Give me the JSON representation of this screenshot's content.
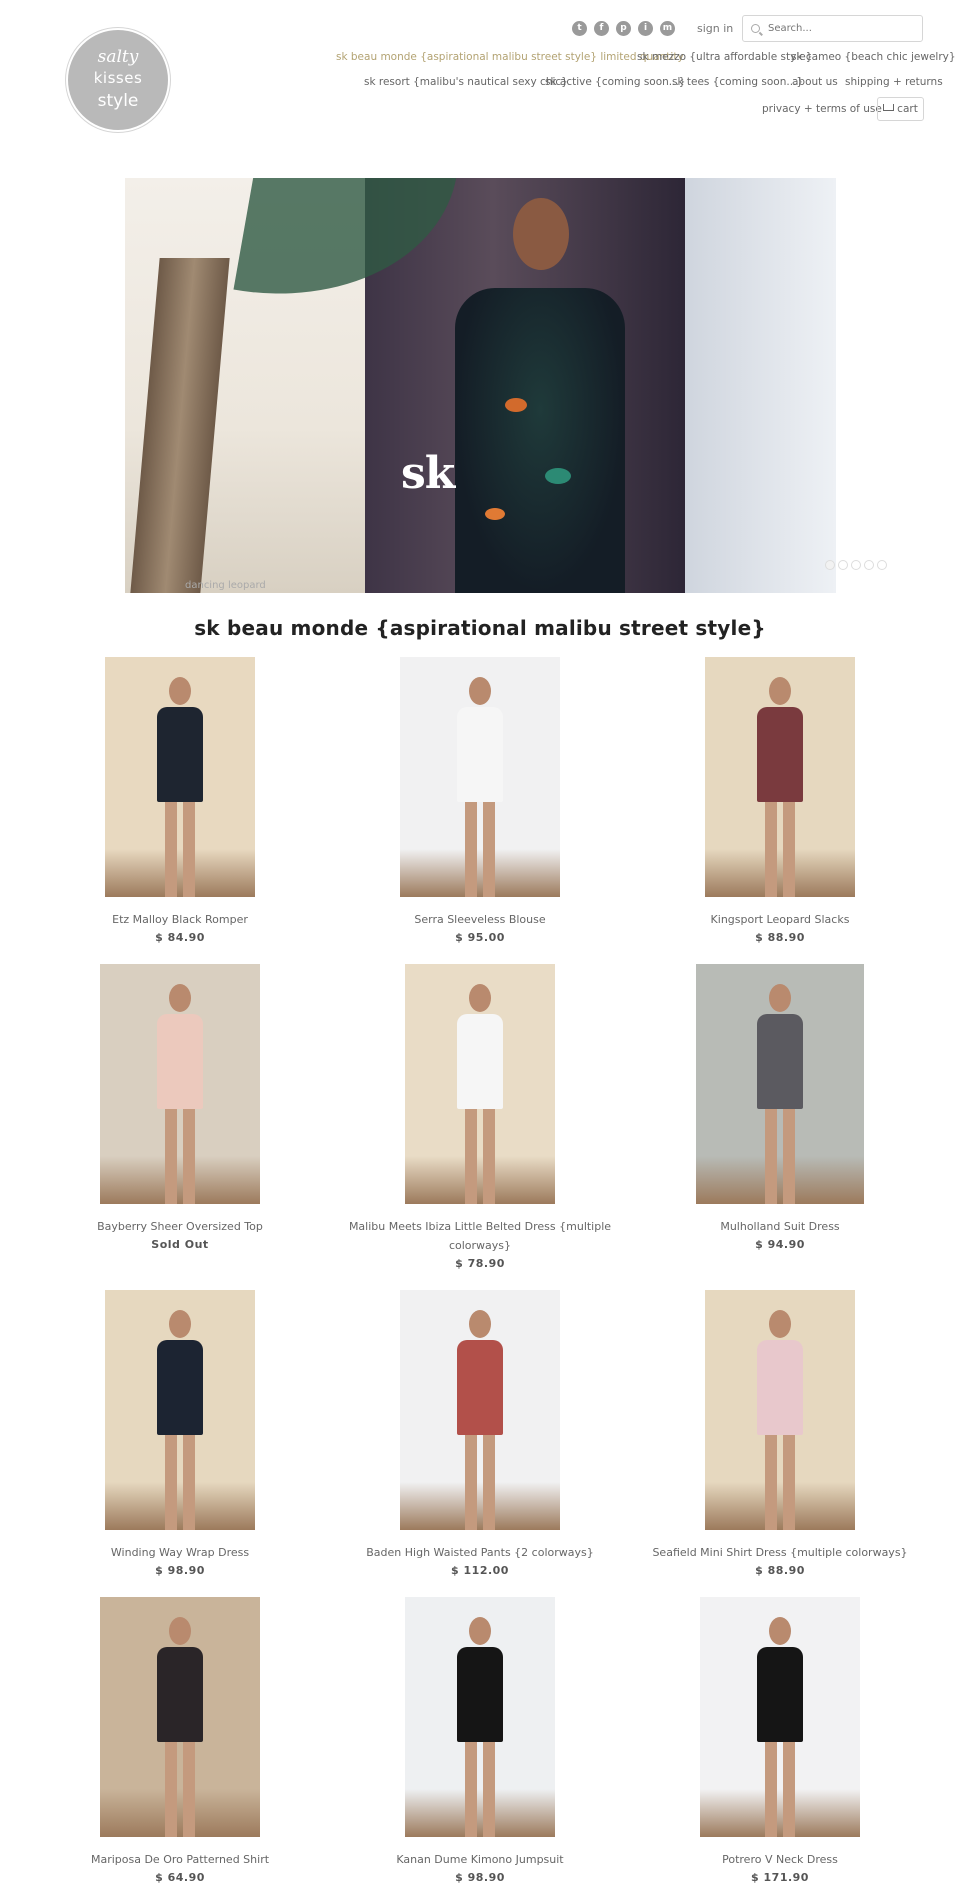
{
  "logo": {
    "line1": "salty",
    "line2": "kisses",
    "line3": "style"
  },
  "header": {
    "social": [
      "t",
      "f",
      "p",
      "i",
      "m"
    ],
    "sign_in": "sign in",
    "search_placeholder": "Search...",
    "cart_label": "cart"
  },
  "nav": {
    "row1": [
      "sk beau monde {aspirational malibu street style} limited quantity",
      "sk mezzo {ultra affordable style}",
      "sk cameo {beach chic jewelry}"
    ],
    "row2": [
      "sk resort {malibu's nautical sexy chic}",
      "sk active {coming soon...}",
      "sk tees {coming soon...}",
      "about us",
      "shipping + returns"
    ],
    "row3": [
      "privacy + terms of use"
    ]
  },
  "slideshow": {
    "caption": "dancing leopard",
    "logo_mark": "sk",
    "dot_count": 5,
    "active_dot": 1
  },
  "collection": {
    "title": "sk beau monde {aspirational malibu street style}",
    "products": [
      {
        "name": "Etz Malloy Black Romper",
        "price": "$ 84.90",
        "bg": "#e8d9c0",
        "outfit": "#1e2530"
      },
      {
        "name": "Serra Sleeveless Blouse",
        "price": "$ 95.00",
        "bg": "#f1f1f2",
        "outfit": "#f6f6f6"
      },
      {
        "name": "Kingsport Leopard Slacks",
        "price": "$ 88.90",
        "bg": "#e6d8bf",
        "outfit": "#7a3a3e"
      },
      {
        "name": "Bayberry Sheer Oversized Top",
        "price": "Sold Out",
        "bg": "#d9cfc0",
        "outfit": "#ecc9bd"
      },
      {
        "name": "Malibu Meets Ibiza Little Belted Dress {multiple colorways}",
        "price": "$ 78.90",
        "bg": "#e9dcc6",
        "outfit": "#f6f6f6"
      },
      {
        "name": "Mulholland Suit Dress",
        "price": "$ 94.90",
        "bg": "#b8bbb6",
        "outfit": "#5b5a60"
      },
      {
        "name": "Winding Way Wrap Dress",
        "price": "$ 98.90",
        "bg": "#e6d8bf",
        "outfit": "#1c2432"
      },
      {
        "name": "Baden High Waisted Pants {2 colorways}",
        "price": "$ 112.00",
        "bg": "#f1f1f2",
        "outfit": "#b2504a"
      },
      {
        "name": "Seafield Mini Shirt Dress {multiple colorways}",
        "price": "$ 88.90",
        "bg": "#e6d8bf",
        "outfit": "#e8c8cc"
      },
      {
        "name": "Mariposa De Oro Patterned Shirt",
        "price": "$ 64.90",
        "bg": "#c9b49a",
        "outfit": "#2a2528"
      },
      {
        "name": "Kanan Dume Kimono Jumpsuit",
        "price": "$ 98.90",
        "bg": "#eef0f2",
        "outfit": "#151515"
      },
      {
        "name": "Potrero V Neck Dress",
        "price": "$ 171.90",
        "bg": "#f2f2f3",
        "outfit": "#151515"
      }
    ]
  }
}
